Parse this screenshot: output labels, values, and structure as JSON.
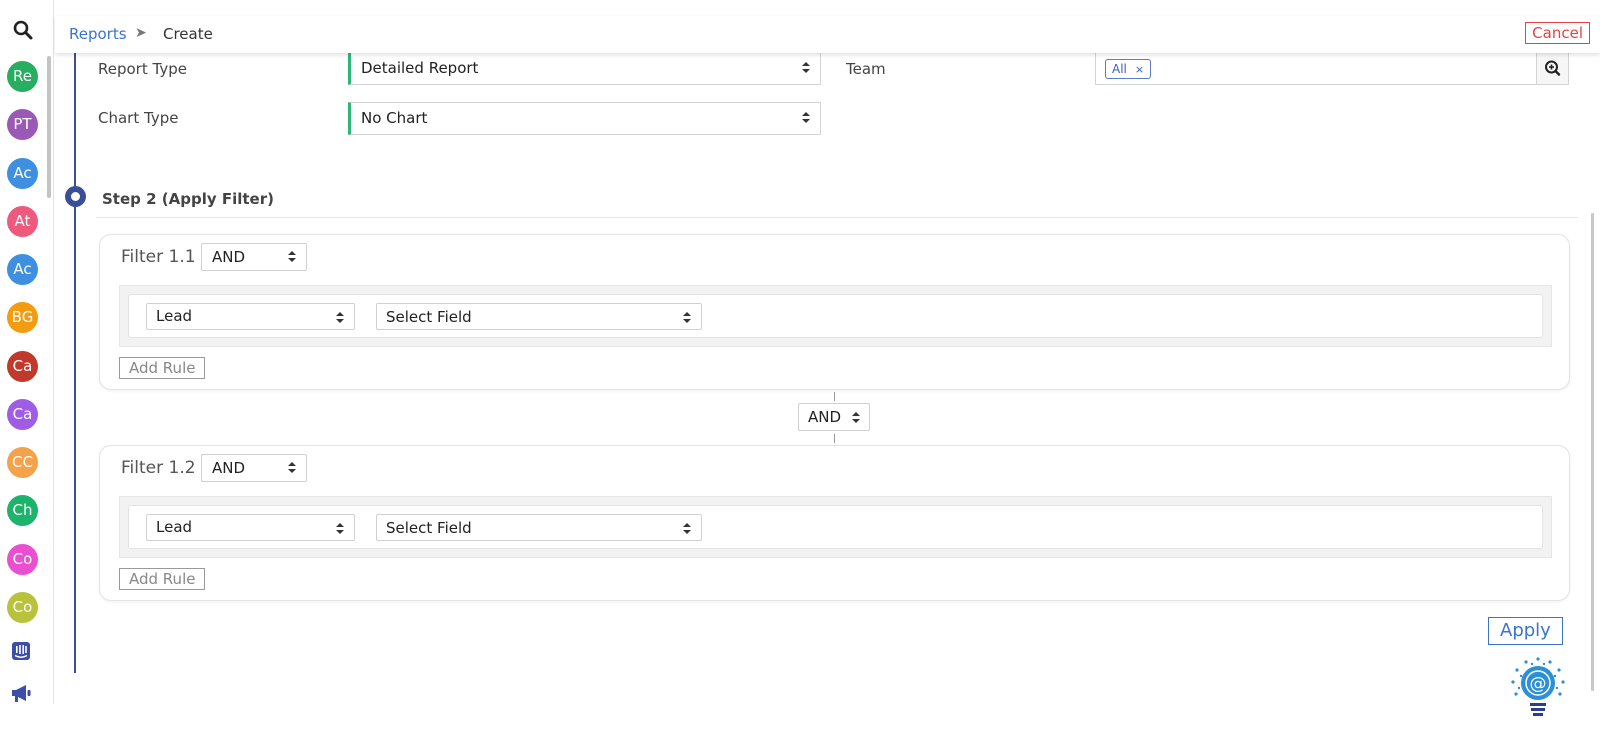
{
  "sidebar": {
    "search_icon": "search-icon",
    "avatars": [
      {
        "initials": "Re",
        "color": "#27ae60"
      },
      {
        "initials": "PT",
        "color": "#9b59b6"
      },
      {
        "initials": "Ac",
        "color": "#3f8fe0"
      },
      {
        "initials": "At",
        "color": "#ee5a7d"
      },
      {
        "initials": "Ac",
        "color": "#3f8fe0"
      },
      {
        "initials": "BG",
        "color": "#f39c12"
      },
      {
        "initials": "Ca",
        "color": "#c0392b"
      },
      {
        "initials": "Ca",
        "color": "#a05ce6"
      },
      {
        "initials": "CC",
        "color": "#f5a34a"
      },
      {
        "initials": "Ch",
        "color": "#1cb46a"
      },
      {
        "initials": "Co",
        "color": "#ea4fd2"
      },
      {
        "initials": "Co",
        "color": "#b8c23a"
      }
    ],
    "bottom_icons": [
      "intercom-icon",
      "megaphone-icon"
    ]
  },
  "header": {
    "breadcrumb_root": "Reports",
    "breadcrumb_sep": "➤",
    "breadcrumb_current": "Create",
    "cancel_label": "Cancel"
  },
  "step1": {
    "report_type_label": "Report Type",
    "report_type_value": "Detailed Report",
    "team_label": "Team",
    "team_chip": "All",
    "team_chip_remove": "×",
    "chart_type_label": "Chart Type",
    "chart_type_value": "No Chart"
  },
  "step2": {
    "title": "Step 2 (Apply Filter)",
    "filters": [
      {
        "title": "Filter 1.1",
        "operator": "AND",
        "entity": "Lead",
        "field": "Select Field",
        "add_rule": "Add Rule"
      },
      {
        "title": "Filter 1.2",
        "operator": "AND",
        "entity": "Lead",
        "field": "Select Field",
        "add_rule": "Add Rule"
      }
    ],
    "between_operator": "AND",
    "apply_label": "Apply"
  },
  "colors": {
    "accent_blue": "#3b74c9",
    "step_navy": "#3a4f98",
    "cancel_red": "#e14444",
    "select_accent_green": "#2fb67a"
  }
}
